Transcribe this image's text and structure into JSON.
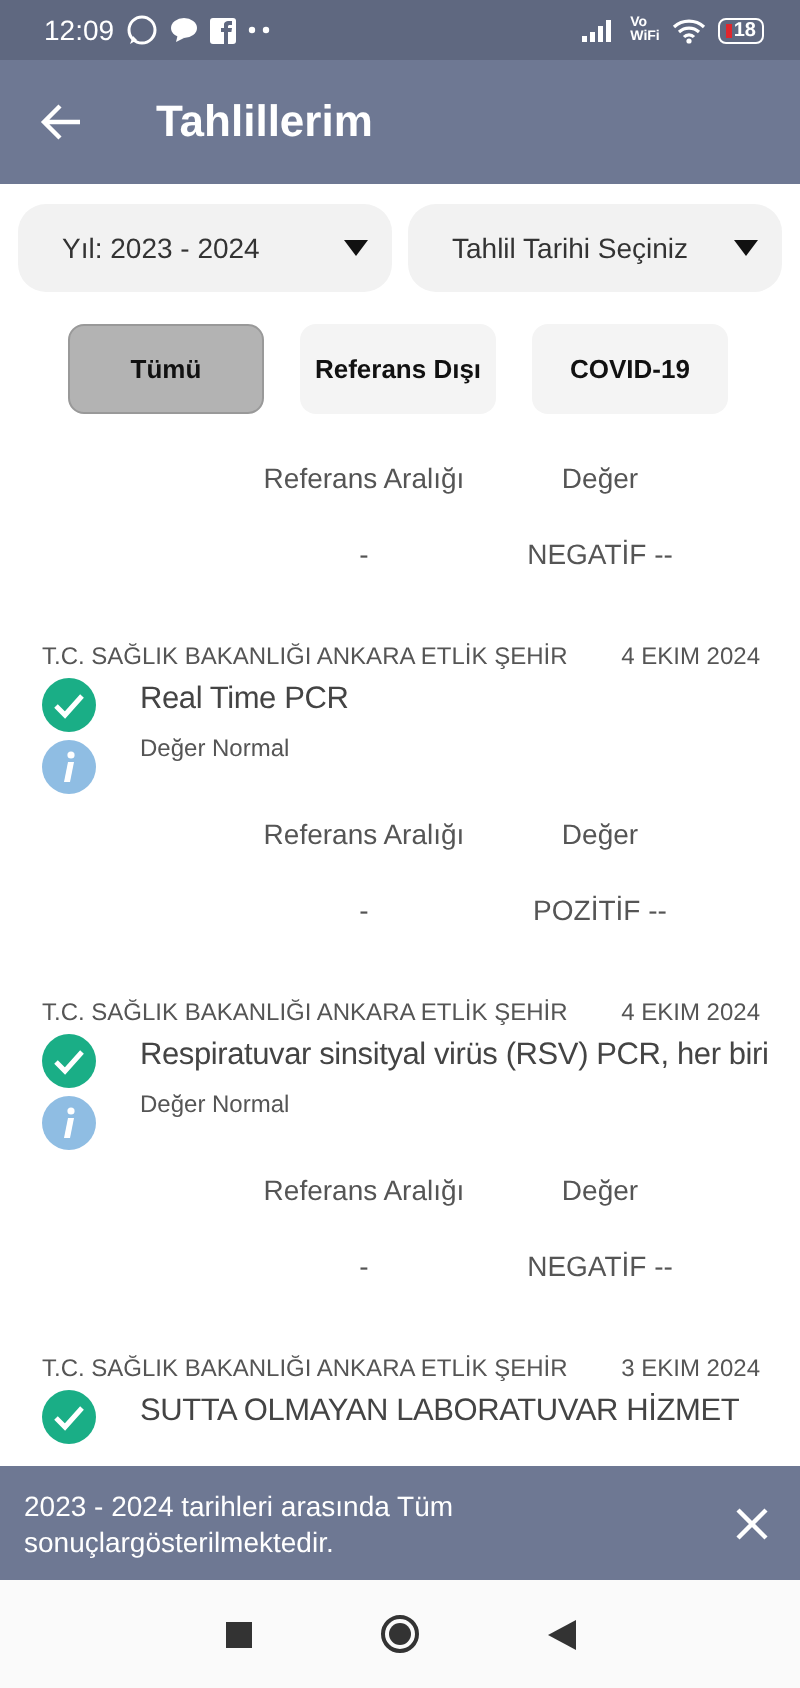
{
  "status_bar": {
    "time": "12:09",
    "network_label": [
      "Vo",
      "WiFi"
    ],
    "battery": "18"
  },
  "app_bar": {
    "title": "Tahlillerim"
  },
  "filters": [
    {
      "label": "Yıl: 2023 - 2024"
    },
    {
      "label": "Tahlil Tarihi Seçiniz"
    }
  ],
  "tabs": [
    {
      "label": "Tümü",
      "selected": true
    },
    {
      "label": "Referans Dışı",
      "selected": false
    },
    {
      "label": "COVID-19",
      "selected": false
    }
  ],
  "results": [
    {
      "kind": "partial",
      "reference_header": "Referans Aralığı",
      "value_header": "Değer",
      "reference": "-",
      "value": "NEGATİF --"
    },
    {
      "kind": "full",
      "institution": "T.C. SAĞLIK BAKANLIĞI ANKARA ETLİK ŞEHİR",
      "date": "4 EKIM 2024",
      "title": "Real Time PCR",
      "note": "Değer Normal",
      "normal": true,
      "reference_header": "Referans Aralığı",
      "value_header": "Değer",
      "reference": "-",
      "value": "POZİTİF --"
    },
    {
      "kind": "full",
      "institution": "T.C. SAĞLIK BAKANLIĞI ANKARA ETLİK ŞEHİR",
      "date": "4 EKIM 2024",
      "title": "Respiratuvar sinsityal virüs (RSV) PCR, her biri",
      "note": "Değer Normal",
      "normal": true,
      "reference_header": "Referans Aralığı",
      "value_header": "Değer",
      "reference": "-",
      "value": "NEGATİF --"
    },
    {
      "kind": "cut",
      "institution": "T.C. SAĞLIK BAKANLIĞI ANKARA ETLİK ŞEHİR",
      "date": "3 EKIM 2024",
      "title": "SUTTA OLMAYAN LABORATUVAR HİZMET",
      "normal": true
    }
  ],
  "snackbar": {
    "message": "2023 - 2024 tarihleri arasında Tüm sonuçlargösterilmektedir."
  }
}
